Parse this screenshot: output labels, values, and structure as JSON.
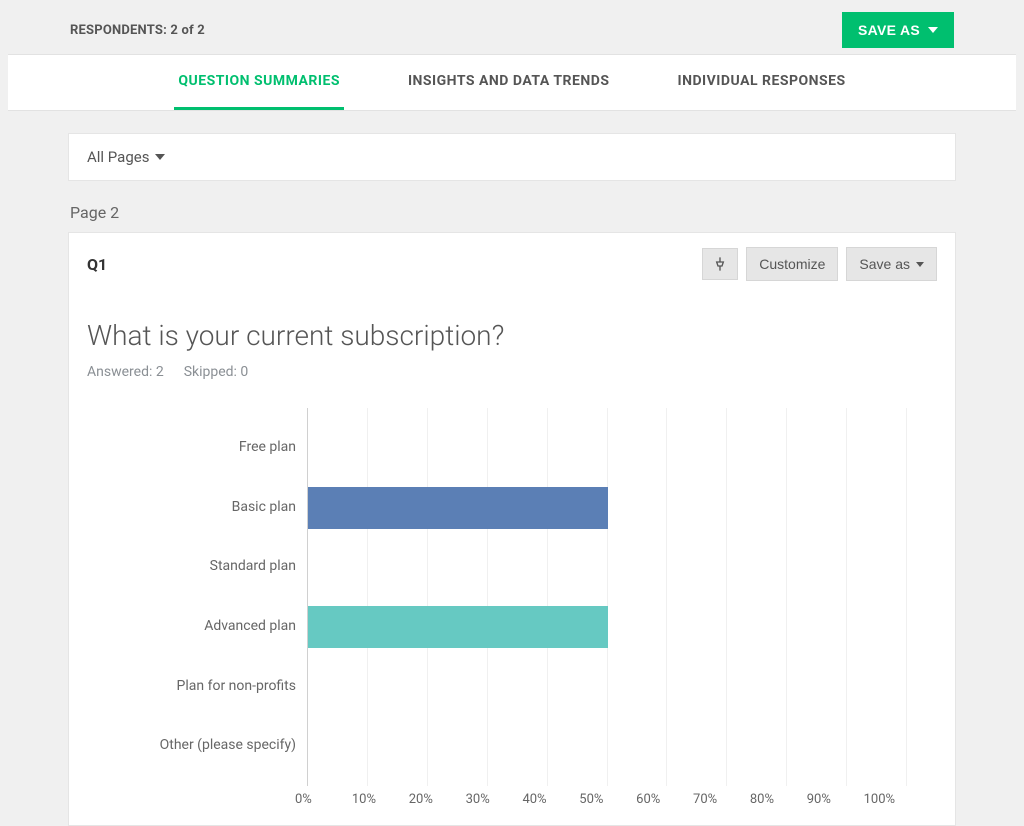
{
  "header": {
    "respondents_label": "RESPONDENTS: 2 of 2",
    "save_as_label": "SAVE AS"
  },
  "tabs": {
    "question_summaries": "QUESTION SUMMARIES",
    "insights": "INSIGHTS AND DATA TRENDS",
    "individual": "INDIVIDUAL RESPONSES"
  },
  "page_filter": {
    "label": "All Pages"
  },
  "page_section_label": "Page 2",
  "question": {
    "number": "Q1",
    "pin_tooltip": "Pin",
    "customize_label": "Customize",
    "save_as_label": "Save as",
    "title": "What is your current subscription?",
    "answered_label": "Answered: 2",
    "skipped_label": "Skipped: 0"
  },
  "chart_data": {
    "type": "bar",
    "orientation": "horizontal",
    "xlabel": "",
    "ylabel": "",
    "xlim": [
      0,
      100
    ],
    "x_ticks": [
      "0%",
      "10%",
      "20%",
      "30%",
      "40%",
      "50%",
      "60%",
      "70%",
      "80%",
      "90%",
      "100%"
    ],
    "categories": [
      "Free plan",
      "Basic plan",
      "Standard plan",
      "Advanced plan",
      "Plan for non-profits",
      "Other (please specify)"
    ],
    "values": [
      0,
      50,
      0,
      50,
      0,
      0
    ],
    "colors": [
      "#5b7fb5",
      "#5b7fb5",
      "#5b7fb5",
      "#66c9c2",
      "#5b7fb5",
      "#5b7fb5"
    ]
  }
}
